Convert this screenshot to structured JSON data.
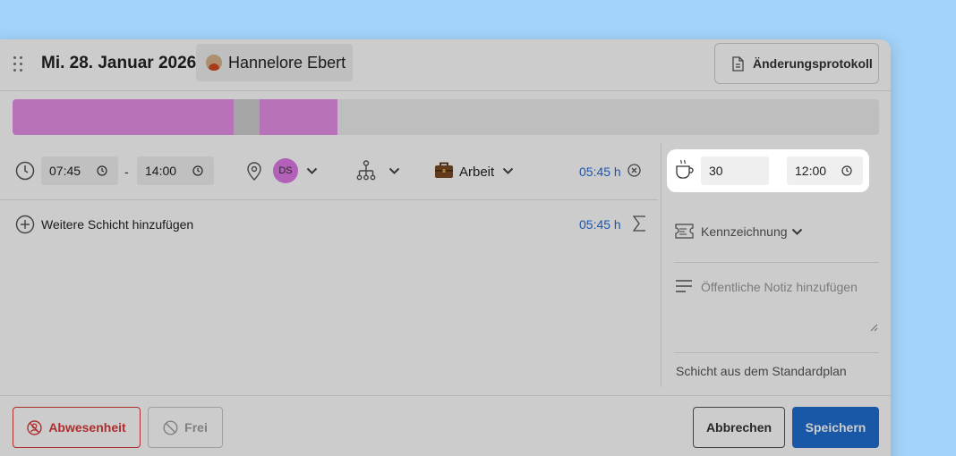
{
  "header": {
    "title": "Mi. 28. Januar 2026",
    "person_name": "Hannelore Ebert",
    "protocol_label": "Änderungsprotokoll"
  },
  "timeline": {
    "segments": [
      {
        "color": "#e58fe9",
        "from": 0.0,
        "to": 0.255
      },
      {
        "color": "#cfcfcf",
        "from": 0.255,
        "to": 0.285
      },
      {
        "color": "#e58fe9",
        "from": 0.285,
        "to": 0.375
      }
    ]
  },
  "shift": {
    "start": "07:45",
    "separator": "-",
    "end": "14:00",
    "employee_initials": "DS",
    "category": "Arbeit",
    "duration": "05:45 h"
  },
  "add_shift": {
    "label": "Weitere Schicht hinzufügen",
    "total": "05:45 h"
  },
  "break": {
    "minutes": "30",
    "time": "12:00"
  },
  "side": {
    "kennzeichnung_label": "Kennzeichnung",
    "note_placeholder": "Öffentliche Notiz hinzufügen",
    "standard_plan": "Schicht aus dem Standardplan"
  },
  "footer": {
    "absence_label": "Abwesenheit",
    "free_label": "Frei",
    "cancel_label": "Abbrechen",
    "save_label": "Speichern"
  },
  "colors": {
    "accent": "#1f6fd1",
    "danger": "#d93a3a",
    "shift_bar": "#e58fe9",
    "backdrop": "#a3d3f9"
  }
}
